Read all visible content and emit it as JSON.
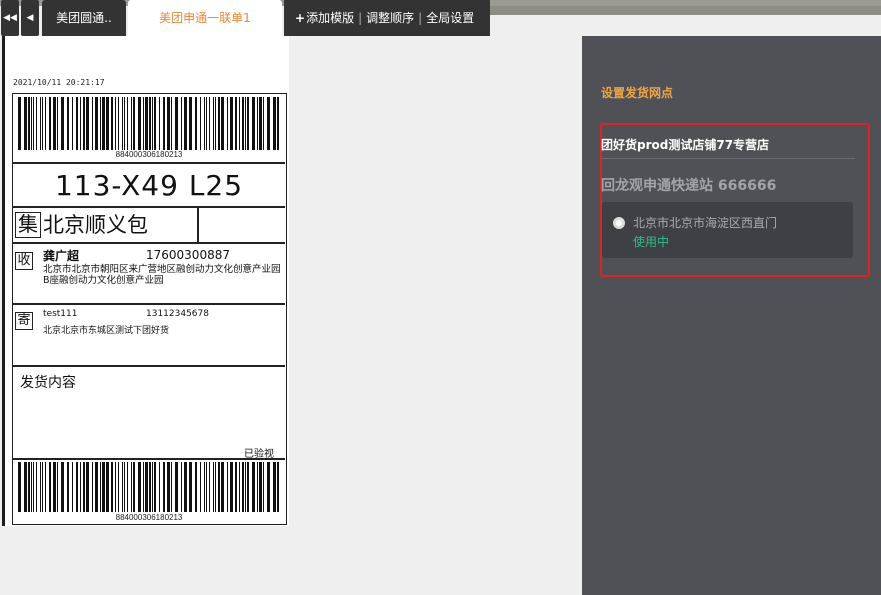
{
  "tabs": [
    {
      "label": "美团圆通..",
      "active": false
    },
    {
      "label": "美团申通一联单1",
      "active": true
    }
  ],
  "toolbar": {
    "add_template": "添加模版",
    "reorder": "调整顺序",
    "global_settings": "全局设置"
  },
  "nav": {
    "first_icon": "double-left-arrow",
    "prev_icon": "left-arrow"
  },
  "label": {
    "timestamp": "2021/10/11  20:21:17",
    "barcode_number": "884000306180213",
    "sort_code": "113-X49  L25",
    "collect_badge": "集",
    "collect_package": "北京顺义包",
    "receiver_badge": "收",
    "receiver_name": "龚广超",
    "receiver_phone": "17600300887",
    "receiver_address": "北京市北京市朝阳区来广营地区融创动力文化创意产业园B座融创动力文化创意产业园",
    "sender_badge": "寄",
    "sender_name": "test111",
    "sender_phone": "13112345678",
    "sender_address": "北京北京市东城区测试下团好货",
    "content_label": "发货内容",
    "inspected": "已验视",
    "bottom_barcode_number": "884000306180213"
  },
  "panel": {
    "title": "设置发货网点",
    "store_name": "团好货prod测试店铺77专营店",
    "station": "回龙观申通快递站 666666",
    "address": "北京市北京市海淀区西直门",
    "status": "使用中",
    "colors": {
      "title": "#f0a640",
      "status": "#27c08a",
      "highlight_border": "#e52222"
    }
  }
}
